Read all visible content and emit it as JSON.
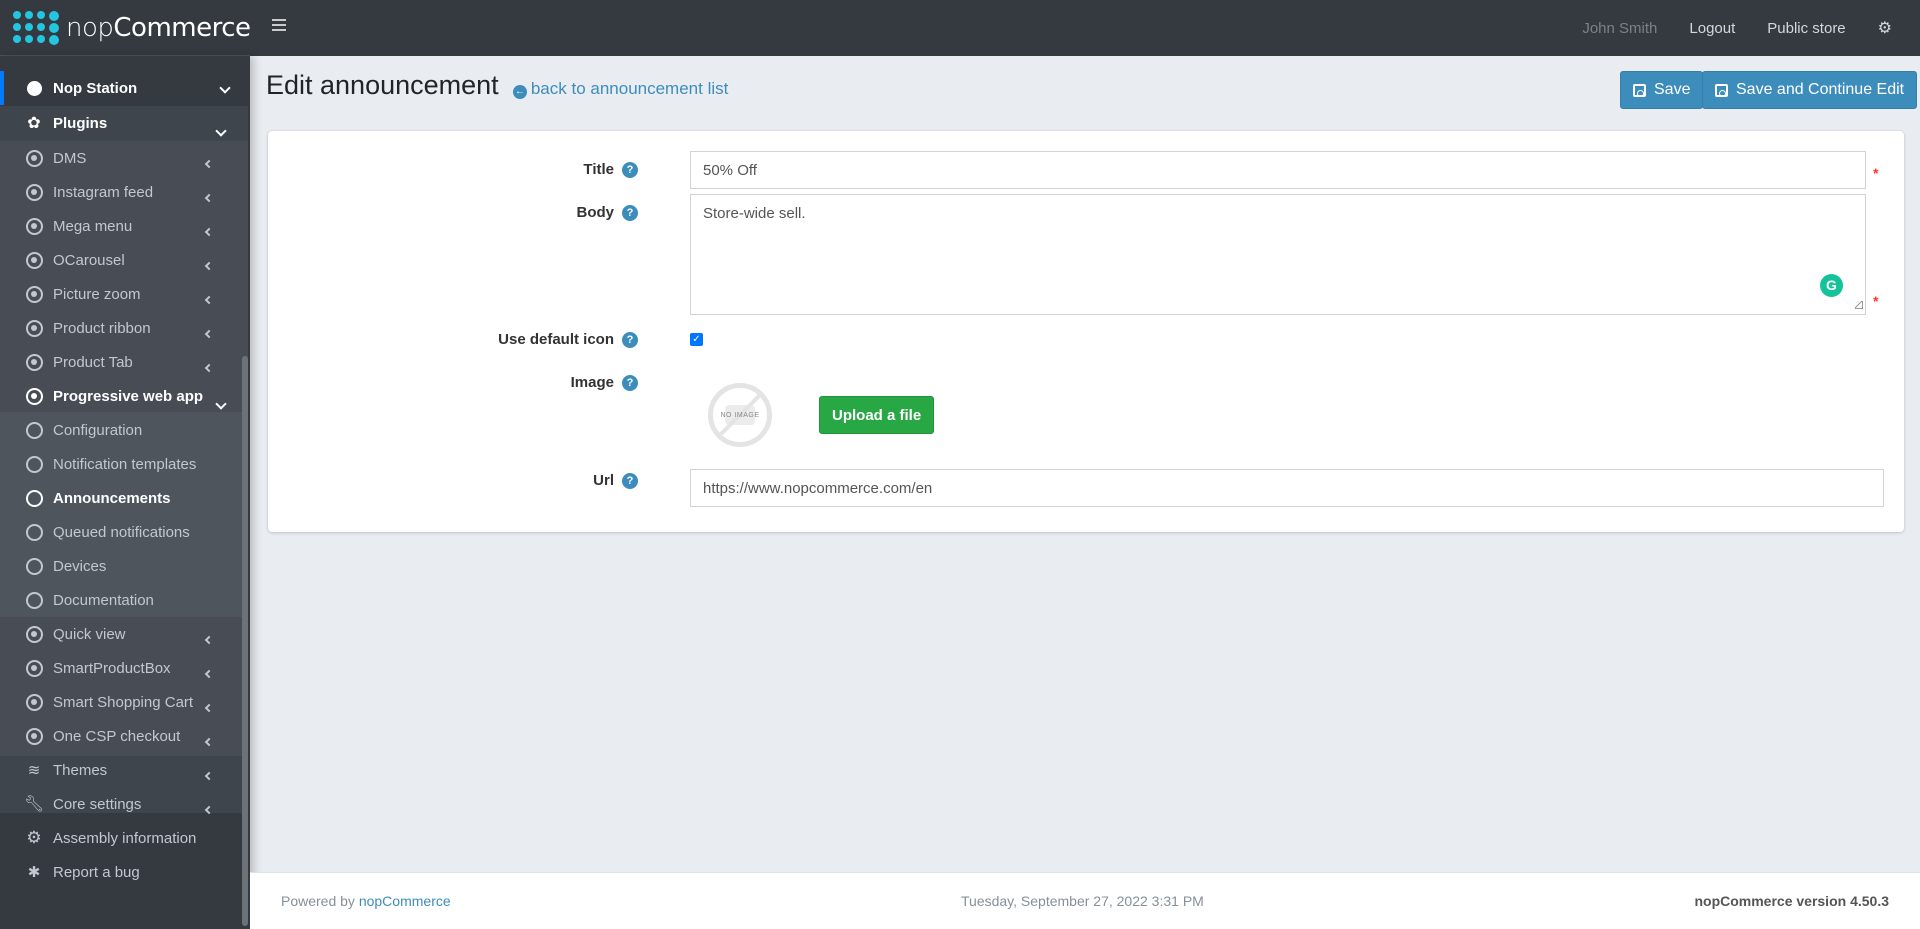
{
  "header": {
    "logo_prefix": "nop",
    "logo_suffix": "Commerce",
    "user_name": "John Smith",
    "logout_label": "Logout",
    "public_store_label": "Public store"
  },
  "sidebar": {
    "items": [
      {
        "label": "Nop Station",
        "icon": "nop-station-icon",
        "state": "expanded"
      },
      {
        "label": "Plugins",
        "icon": "puzzle-icon",
        "state": "expanded"
      },
      {
        "label": "DMS",
        "icon": "dot-circle-icon",
        "state": "collapsed"
      },
      {
        "label": "Instagram feed",
        "icon": "dot-circle-icon",
        "state": "collapsed"
      },
      {
        "label": "Mega menu",
        "icon": "dot-circle-icon",
        "state": "collapsed"
      },
      {
        "label": "OCarousel",
        "icon": "dot-circle-icon",
        "state": "collapsed"
      },
      {
        "label": "Picture zoom",
        "icon": "dot-circle-icon",
        "state": "collapsed"
      },
      {
        "label": "Product ribbon",
        "icon": "dot-circle-icon",
        "state": "collapsed"
      },
      {
        "label": "Product Tab",
        "icon": "dot-circle-icon",
        "state": "collapsed"
      },
      {
        "label": "Progressive web app",
        "icon": "dot-circle-icon",
        "state": "expanded"
      },
      {
        "label": "Configuration",
        "icon": "circle-icon"
      },
      {
        "label": "Notification templates",
        "icon": "circle-icon"
      },
      {
        "label": "Announcements",
        "icon": "circle-icon",
        "state": "active"
      },
      {
        "label": "Queued notifications",
        "icon": "circle-icon"
      },
      {
        "label": "Devices",
        "icon": "circle-icon"
      },
      {
        "label": "Documentation",
        "icon": "circle-icon"
      },
      {
        "label": "Quick view",
        "icon": "dot-circle-icon",
        "state": "collapsed"
      },
      {
        "label": "SmartProductBox",
        "icon": "dot-circle-icon",
        "state": "collapsed"
      },
      {
        "label": "Smart Shopping Cart",
        "icon": "dot-circle-icon",
        "state": "collapsed"
      },
      {
        "label": "One CSP checkout",
        "icon": "dot-circle-icon",
        "state": "collapsed"
      },
      {
        "label": "Themes",
        "icon": "layers-icon",
        "state": "collapsed"
      },
      {
        "label": "Core settings",
        "icon": "wrench-icon",
        "state": "collapsed"
      },
      {
        "label": "Assembly information",
        "icon": "gear-icon"
      },
      {
        "label": "Report a bug",
        "icon": "bug-icon"
      }
    ]
  },
  "page": {
    "title": "Edit announcement",
    "back_link": "back to announcement list",
    "save_label": "Save",
    "save_continue_label": "Save and Continue Edit"
  },
  "form": {
    "title_label": "Title",
    "title_value": "50% Off",
    "body_label": "Body",
    "body_value": "Store-wide sell.",
    "use_default_icon_label": "Use default icon",
    "use_default_icon_checked": true,
    "image_label": "Image",
    "no_image_text": "NO IMAGE",
    "upload_label": "Upload a file",
    "url_label": "Url",
    "url_value": "https://www.nopcommerce.com/en",
    "help_glyph": "?",
    "required_marker": "*"
  },
  "footer": {
    "powered_by": "Powered by ",
    "powered_link": "nopCommerce",
    "datetime": "Tuesday, September 27, 2022 3:31 PM",
    "version": "nopCommerce version 4.50.3"
  },
  "colors": {
    "accent": "#3c8dbc",
    "success": "#28a745",
    "sidebar_bg": "#343a40",
    "active_indicator": "#007bff",
    "required": "#ff3333"
  }
}
